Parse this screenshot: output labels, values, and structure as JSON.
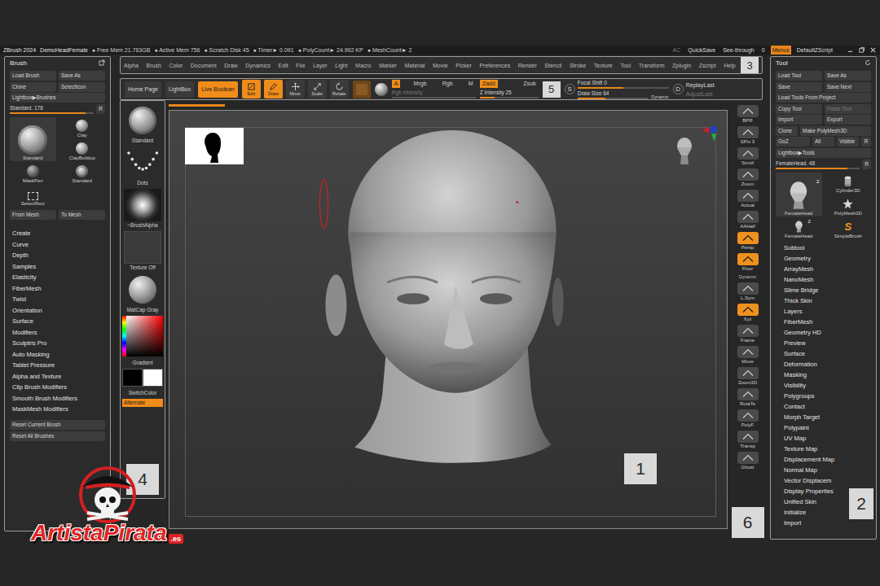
{
  "title_bar": {
    "app": "ZBrush 2024",
    "document": "DemoHeadFemale",
    "stats": [
      "● Free Mem 21.763GB",
      "● Active Mem 756",
      "● Scratch Disk 45",
      "● Timer► 0.091",
      "● PolyCount► 24.992 KP",
      "● MeshCount► 2"
    ],
    "controls": [
      {
        "label": "AC",
        "selected": false,
        "disabled": true
      },
      {
        "label": "QuickSave",
        "selected": false,
        "disabled": false
      },
      {
        "label": "See-through",
        "selected": false,
        "disabled": false
      },
      {
        "label": "0",
        "selected": false,
        "disabled": false
      },
      {
        "label": "Menus",
        "selected": true,
        "disabled": false
      },
      {
        "label": "DefaultZScript",
        "selected": false,
        "disabled": false
      }
    ]
  },
  "menu_bar": {
    "items": [
      "Alpha",
      "Brush",
      "Color",
      "Document",
      "Draw",
      "Dynamics",
      "Edit",
      "File",
      "Layer",
      "Light",
      "Macro",
      "Marker",
      "Material",
      "Movie",
      "Picker",
      "Preferences",
      "Render",
      "Stencil",
      "Stroke",
      "Texture",
      "Tool",
      "Transform",
      "Zplugin",
      "Zscript",
      "Help"
    ],
    "badge": "3"
  },
  "top_shelf": {
    "nav": [
      {
        "label": "Home Page",
        "selected": false
      },
      {
        "label": "LightBox",
        "selected": false
      },
      {
        "label": "Live Boolean",
        "selected": true
      }
    ],
    "modes": [
      {
        "label": "Edit",
        "kind": "edit",
        "selected": true
      },
      {
        "label": "Draw",
        "kind": "draw",
        "selected": true
      },
      {
        "label": "Move",
        "kind": "move",
        "selected": false
      },
      {
        "label": "Scale",
        "kind": "scale",
        "selected": false
      },
      {
        "label": "Rotate",
        "kind": "rotate",
        "selected": false
      }
    ],
    "channels": [
      {
        "label": "A",
        "selected": true
      },
      {
        "label": "Mrgb",
        "selected": false
      },
      {
        "label": "Rgb",
        "selected": false
      },
      {
        "label": "M",
        "selected": false
      }
    ],
    "rgb_intensity": {
      "label": "Rgb Intensity",
      "disabled": true
    },
    "z_modes": [
      {
        "label": "Zadd",
        "selected": true
      },
      {
        "label": "Zsub",
        "selected": false
      }
    ],
    "z_intensity": {
      "label": "Z Intensity",
      "value": "25",
      "level": 0.25
    },
    "badge": "5",
    "focal_icon": "S",
    "focal_shift": {
      "label": "Focal Shift",
      "value": "0",
      "level": 0.5
    },
    "draw_size": {
      "label": "Draw Size",
      "value": "64",
      "level": 0.4
    },
    "dynamic": "Dynamic",
    "replay_icon": "D",
    "replay": [
      {
        "label": "ReplayLast",
        "disabled": false
      },
      {
        "label": "AdjustLast",
        "disabled": true
      }
    ]
  },
  "brush_palette": {
    "title": "Brush",
    "buttons": [
      {
        "label": "Load Brush",
        "kind": "half"
      },
      {
        "label": "Save As",
        "kind": "half"
      },
      {
        "label": "Clone",
        "kind": "half"
      },
      {
        "label": "SelectIcon",
        "kind": "half"
      },
      {
        "label": "Lightbox▶Brushes",
        "kind": "full"
      }
    ],
    "current": {
      "label": "Standard. 178",
      "level": 0.9
    },
    "reset_key": "R",
    "thumbs": [
      {
        "label": "Standard",
        "kind": "standard",
        "large": true
      },
      {
        "label": "Clay",
        "kind": "clay",
        "large": false
      },
      {
        "label": "ClayBuildup",
        "kind": "clay",
        "large": false
      },
      {
        "label": "MaskPen",
        "kind": "mask",
        "large": false
      },
      {
        "label": "Standard",
        "kind": "standard",
        "large": false
      },
      {
        "label": "SelectRect",
        "kind": "select",
        "large": false
      }
    ],
    "mesh_buttons": [
      "From Mesh",
      "To Mesh"
    ],
    "sections": [
      "Create",
      "Curve",
      "Depth",
      "Samples",
      "Elasticity",
      "FiberMesh",
      "Twist",
      "Orientation",
      "Surface",
      "Modifiers",
      "Sculptris Pro",
      "Auto Masking",
      "Tablet Pressure",
      "Alpha and Texture",
      "Clip Brush Modifiers",
      "Smooth Brush Modifiers",
      "MaskMesh Modifiers"
    ],
    "reset": [
      "Reset Current Brush",
      "Reset All Brushes"
    ]
  },
  "left_shelf": {
    "items": [
      {
        "label": "Standard",
        "kind": "brush"
      },
      {
        "label": "Dots",
        "kind": "stroke"
      },
      {
        "label": "~BrushAlpha",
        "kind": "alpha"
      },
      {
        "label": "Texture Off",
        "kind": "texture"
      },
      {
        "label": "MatCap Gray",
        "kind": "material"
      }
    ],
    "gradient": "Gradient",
    "primary_color": "#000000",
    "secondary_color": "#ffffff",
    "switch": "SwitchColor",
    "alternate": {
      "label": "Alternate",
      "selected": true
    },
    "badge": "4"
  },
  "canvas": {
    "badge": "1",
    "progress": 0.1
  },
  "right_shelf": {
    "items": [
      {
        "label": "BPR",
        "kind": "button",
        "selected": false
      },
      {
        "label": "SPix 3",
        "kind": "button",
        "selected": false
      },
      {
        "label": "Scroll",
        "kind": "button",
        "selected": false
      },
      {
        "label": "Zoom",
        "kind": "button",
        "selected": false
      },
      {
        "label": "Actual",
        "kind": "button",
        "selected": false
      },
      {
        "label": "AAHalf",
        "kind": "button",
        "selected": false
      },
      {
        "label": "Persp",
        "kind": "button",
        "selected": true
      },
      {
        "label": "Floor",
        "kind": "button",
        "selected": true
      },
      {
        "label": "Dynamic",
        "kind": "label",
        "selected": false
      },
      {
        "label": "L.Sym",
        "kind": "button",
        "selected": false
      },
      {
        "label": "Xyz",
        "kind": "button",
        "selected": true
      },
      {
        "label": "Frame",
        "kind": "button",
        "selected": false
      },
      {
        "label": "Move",
        "kind": "button",
        "selected": false
      },
      {
        "label": "Zoom3D",
        "kind": "button",
        "selected": false
      },
      {
        "label": "RotaTe",
        "kind": "button",
        "selected": false
      },
      {
        "label": "PolyF",
        "kind": "button",
        "selected": false
      },
      {
        "label": "Transp",
        "kind": "button",
        "selected": false
      },
      {
        "label": "Ghost",
        "kind": "button",
        "selected": false
      }
    ],
    "badge": "6"
  },
  "tool_palette": {
    "title": "Tool",
    "buttons": [
      {
        "label": "Load Tool",
        "kind": "half",
        "disabled": false
      },
      {
        "label": "Save As",
        "kind": "half",
        "disabled": false
      },
      {
        "label": "Save",
        "kind": "half",
        "disabled": false
      },
      {
        "label": "Save Next",
        "kind": "half",
        "disabled": false
      },
      {
        "label": "Load Tools From Project",
        "kind": "full",
        "disabled": false
      },
      {
        "label": "Copy Tool",
        "kind": "half",
        "disabled": false
      },
      {
        "label": "Paste Tool",
        "kind": "half",
        "disabled": true
      },
      {
        "label": "Import",
        "kind": "half",
        "disabled": false
      },
      {
        "label": "Export",
        "kind": "half",
        "disabled": false
      },
      {
        "label": "Clone",
        "kind": "small",
        "disabled": false
      },
      {
        "label": "Make PolyMesh3D",
        "kind": "large",
        "disabled": false
      },
      {
        "label": "GoZ",
        "kind": "medium",
        "disabled": false
      },
      {
        "label": "All",
        "kind": "small",
        "disabled": false
      },
      {
        "label": "Visible",
        "kind": "small",
        "disabled": false
      },
      {
        "label": "R",
        "kind": "tiny",
        "disabled": false
      },
      {
        "label": "Lightbox▶Tools",
        "kind": "full",
        "disabled": false
      }
    ],
    "current": {
      "label": "FemaleHead. 48",
      "level": 0.85
    },
    "reset_key": "R",
    "thumbs": [
      {
        "label": "FemaleHead",
        "kind": "head",
        "large": true,
        "count": "2"
      },
      {
        "label": "Cylinder3D",
        "kind": "cylinder",
        "large": false
      },
      {
        "label": "PolyMesh3D",
        "kind": "star",
        "large": false
      },
      {
        "label": "FemaleHead",
        "kind": "head",
        "large": false,
        "count": "2"
      },
      {
        "label": "SimpleBrush",
        "kind": "simple",
        "large": false,
        "icon": "S"
      }
    ],
    "sections": [
      "Subtool",
      "Geometry",
      "ArrayMesh",
      "NanoMesh",
      "Slime Bridge",
      "Thick Skin",
      "Layers",
      "FiberMesh",
      "Geometry HD",
      "Preview",
      "Surface",
      "Deformation",
      "Masking",
      "Visibility",
      "Polygroups",
      "Contact",
      "Morph Target",
      "Polypaint",
      "UV Map",
      "Texture Map",
      "Displacement Map",
      "Normal Map",
      "Vector Displacem",
      "Display Properties",
      "Unified Skin",
      "Initialize",
      "Import"
    ],
    "badge": "2"
  },
  "logo": {
    "name": "ArtistaPirata",
    "suffix": ".es"
  }
}
